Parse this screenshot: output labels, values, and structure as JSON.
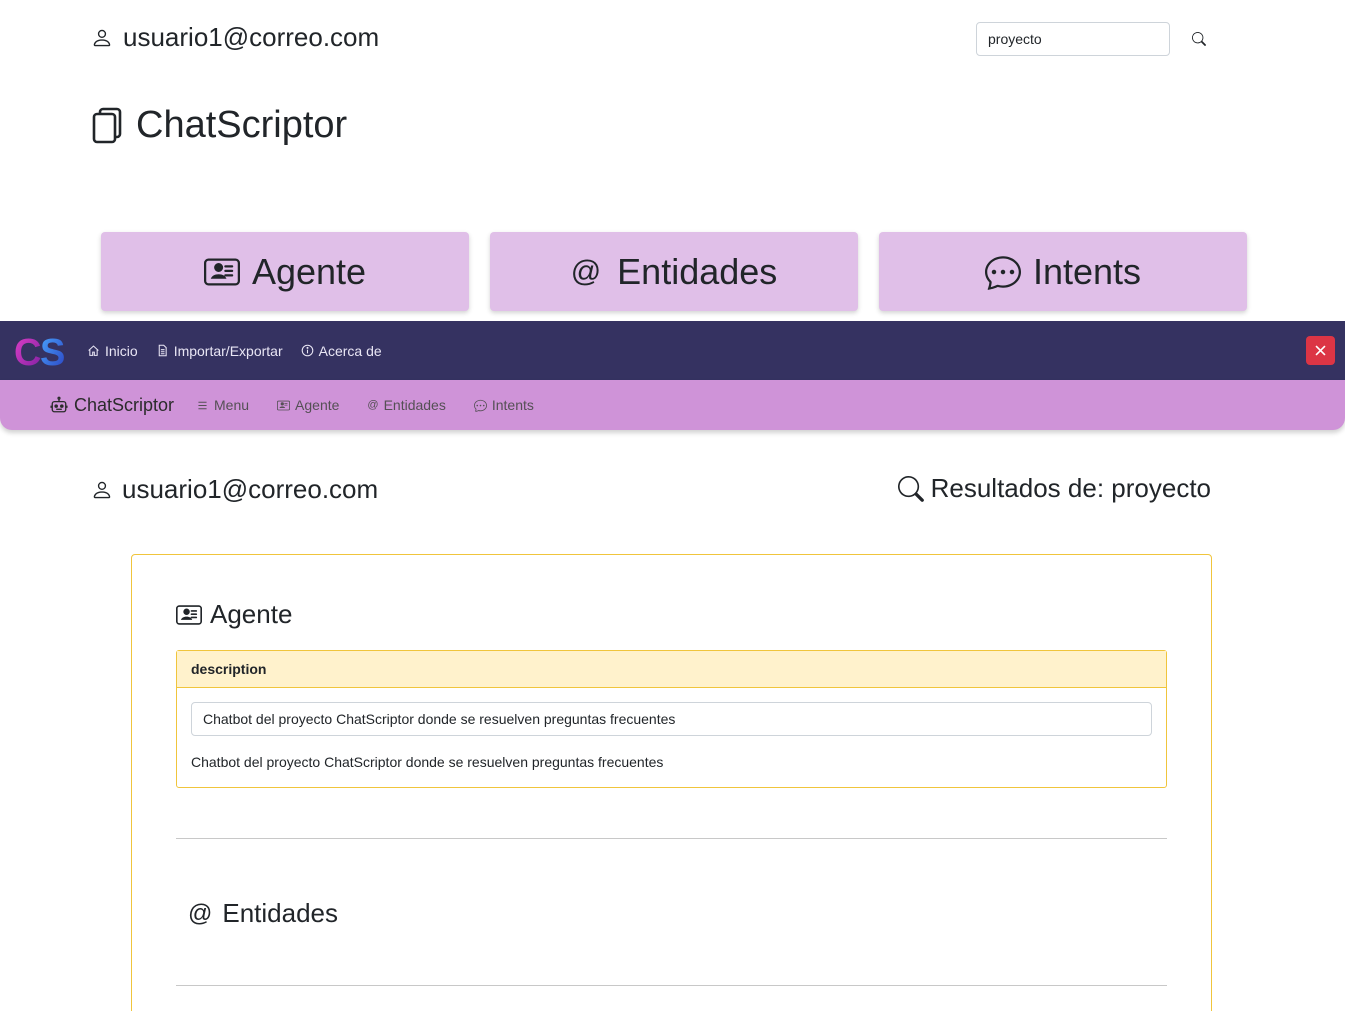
{
  "header": {
    "user_email": "usuario1@correo.com",
    "search_value": "proyecto",
    "brand_title": "ChatScriptor"
  },
  "cards": [
    {
      "label": "Agente",
      "icon": "person-card-icon"
    },
    {
      "label": "Entidades",
      "icon": "at-icon"
    },
    {
      "label": "Intents",
      "icon": "chat-dots-icon"
    }
  ],
  "navbar": {
    "logo_text": "CS",
    "links": [
      {
        "label": "Inicio",
        "icon": "house-icon"
      },
      {
        "label": "Importar/Exportar",
        "icon": "file-icon"
      },
      {
        "label": "Acerca de",
        "icon": "info-circle-icon"
      }
    ],
    "close_icon": "x-icon",
    "colors": {
      "bg": "#353261",
      "close": "#dc3545"
    }
  },
  "subnav": {
    "brand": "ChatScriptor",
    "links": [
      {
        "label": "Menu",
        "icon": "list-icon"
      },
      {
        "label": "Agente",
        "icon": "person-card-icon"
      },
      {
        "label": "Entidades",
        "icon": "at-icon"
      },
      {
        "label": "Intents",
        "icon": "chat-dots-icon"
      }
    ],
    "colors": {
      "bg": "#cf93d8"
    }
  },
  "results": {
    "user_email": "usuario1@correo.com",
    "title": "Resultados de: proyecto",
    "sections": {
      "agente": {
        "heading": "Agente",
        "field_name": "description",
        "field_value": "Chatbot del proyecto ChatScriptor donde se resuelven preguntas frecuentes",
        "field_text": "Chatbot del proyecto ChatScriptor donde se resuelven preguntas frecuentes"
      },
      "entidades": {
        "heading": "Entidades"
      }
    },
    "colors": {
      "border": "#f0c53c",
      "header_bg": "#fff2cc"
    }
  }
}
